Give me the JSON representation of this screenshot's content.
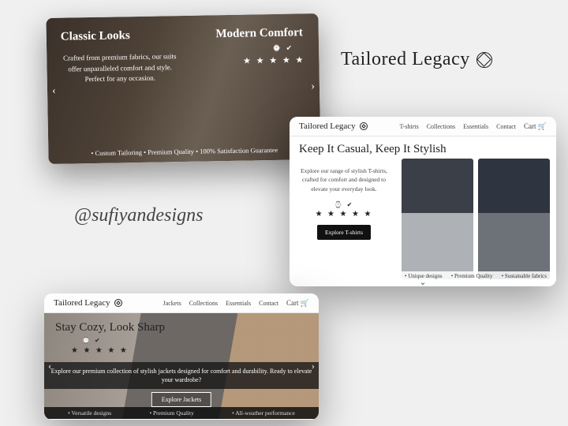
{
  "brand": {
    "name": "Tailored Legacy"
  },
  "handle": "@sufiyandesigns",
  "nav": {
    "tshirts": "T-shirts",
    "jackets": "Jackets",
    "collections": "Collections",
    "essentials": "Essentials",
    "contact": "Contact",
    "cart": "Cart"
  },
  "card1": {
    "title_left": "Classic Looks",
    "title_right": "Modern Comfort",
    "body": "Crafted from premium fabrics, our suits offer unparalleled comfort and style. Perfect for any occasion.",
    "badges": "⌚ ✔",
    "stars": "★ ★ ★ ★ ★",
    "features": "• Custom Tailoring    • Premium Quality    • 100% Satisfaction Guarantee"
  },
  "card2": {
    "title": "Keep It Casual, Keep It Stylish",
    "body": "Explore our range of stylish T-shirts, crafted for comfort and designed to elevate your everyday look.",
    "badges": "⌚ ✔",
    "stars": "★ ★ ★ ★ ★",
    "cta": "Explore T-shirts",
    "features": {
      "a": "• Unique designs",
      "b": "• Premium Quality",
      "c": "• Sustainable fabrics"
    }
  },
  "card3": {
    "title": "Stay Cozy, Look Sharp",
    "badges": "⌚ ✔",
    "stars": "★ ★ ★ ★ ★",
    "body": "Explore our premium collection of stylish jackets designed for comfort and durability. Ready to elevate your wardrobe?",
    "cta": "Explore Jackets",
    "features": {
      "a": "• Versatile designs",
      "b": "• Premium Quality",
      "c": "• All-weather performance"
    }
  }
}
